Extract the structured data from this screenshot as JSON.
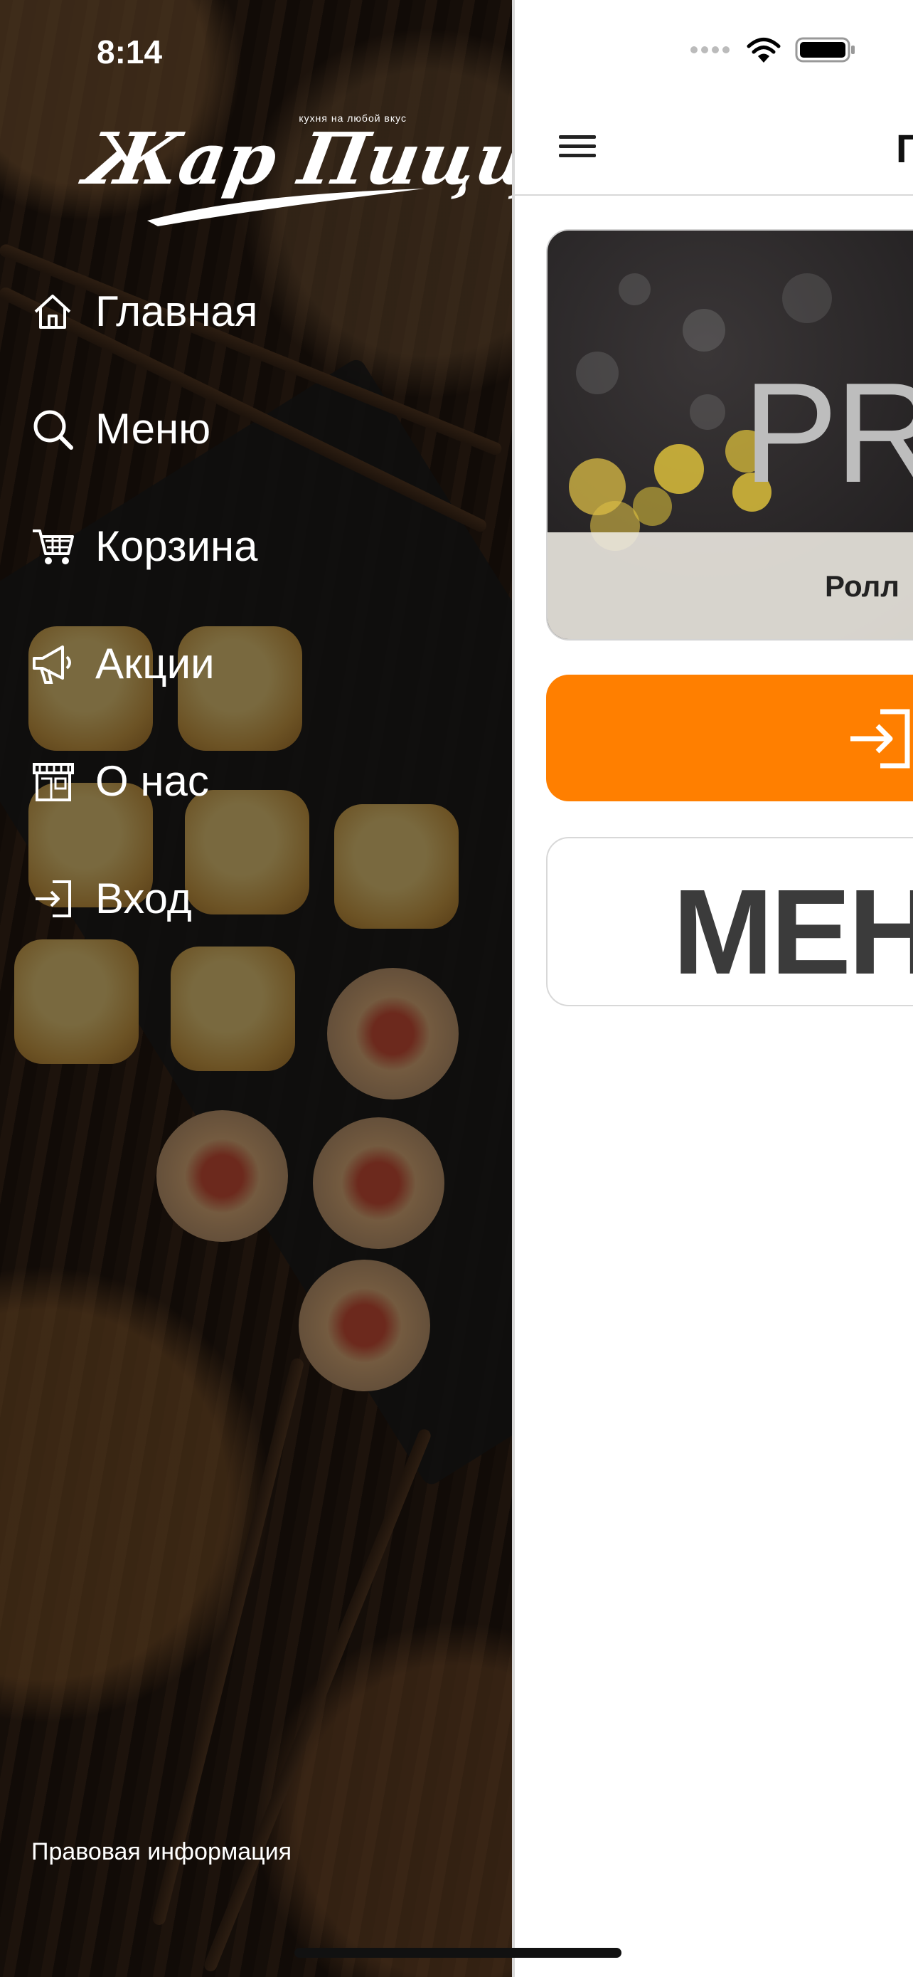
{
  "status_bar": {
    "time": "8:14"
  },
  "drawer": {
    "logo": {
      "name": "Жар Пицца",
      "tagline": "кухня на любой вкус"
    },
    "items": [
      {
        "label": "Главная",
        "icon": "home-icon"
      },
      {
        "label": "Меню",
        "icon": "search-icon"
      },
      {
        "label": "Корзина",
        "icon": "cart-icon"
      },
      {
        "label": "Акции",
        "icon": "megaphone-icon"
      },
      {
        "label": "О нас",
        "icon": "store-icon"
      },
      {
        "label": "Вход",
        "icon": "login-icon"
      }
    ],
    "legal_link": "Правовая информация"
  },
  "main": {
    "title": "Г",
    "promo": {
      "text": "PRO",
      "caption": "Ролл"
    },
    "login_button": {
      "icon": "login-icon"
    },
    "menu_button": {
      "label": "МЕН"
    }
  },
  "colors": {
    "accent": "#ff7f00",
    "drawer_text": "#ffffff"
  }
}
